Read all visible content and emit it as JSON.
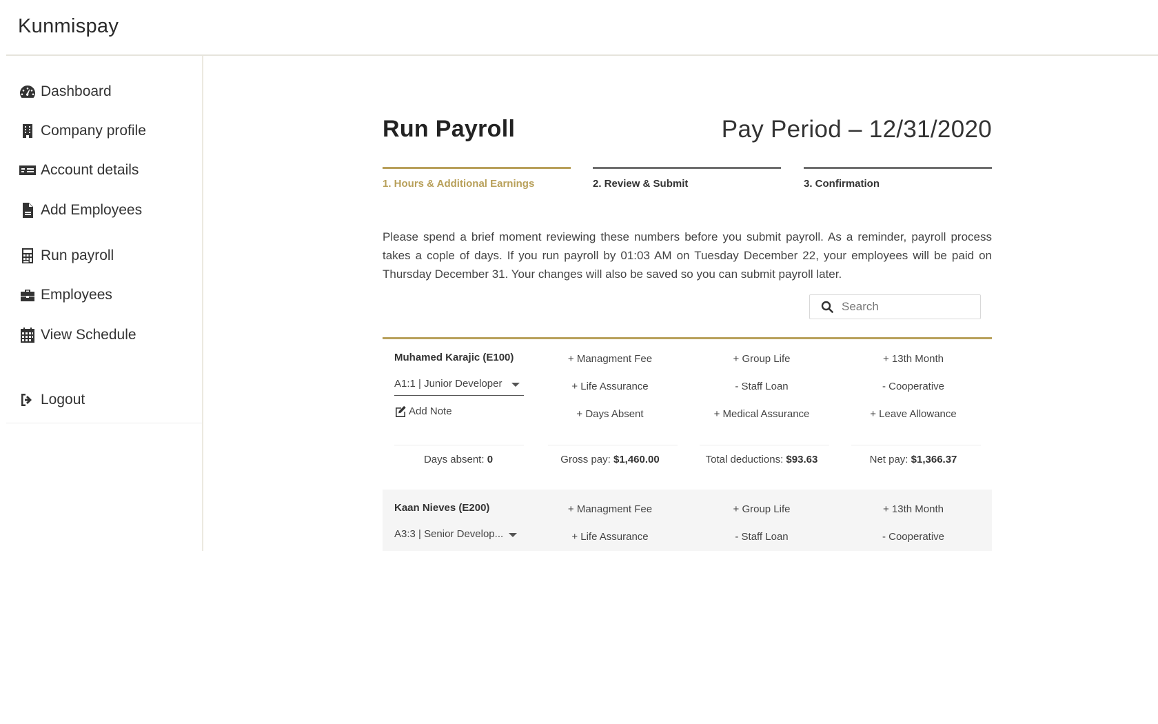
{
  "app": {
    "brand": "Kunmispay"
  },
  "sidebar": {
    "items": [
      {
        "label": "Dashboard",
        "icon": "dashboard-icon"
      },
      {
        "label": "Company profile",
        "icon": "building-icon"
      },
      {
        "label": "Account details",
        "icon": "money-check-icon"
      },
      {
        "label": "Add Employees",
        "icon": "csv-file-icon"
      },
      {
        "label": "Run payroll",
        "icon": "calculator-icon"
      },
      {
        "label": "Employees",
        "icon": "briefcase-icon"
      },
      {
        "label": "View Schedule",
        "icon": "calendar-icon"
      }
    ],
    "logout": {
      "label": "Logout",
      "icon": "sign-out-icon"
    }
  },
  "main": {
    "title": "Run Payroll",
    "pay_period": "Pay Period – 12/31/2020",
    "steps": [
      {
        "label": "1. Hours & Additional Earnings",
        "active": true
      },
      {
        "label": "2. Review & Submit",
        "active": false
      },
      {
        "label": "3. Confirmation",
        "active": false
      }
    ],
    "intro": "Please spend a brief moment reviewing these numbers before you submit payroll. As a reminder, payroll process takes a cople of days. If you run payroll by 01:03 AM on Tuesday December 22, your employees will be paid on Thursday December 31. Your changes will also be saved so you can submit payroll later.",
    "search": {
      "placeholder": "Search"
    }
  },
  "employees": [
    {
      "name": "Muhamed Karajic (E100)",
      "role": "A1:1 | Junior Developer",
      "add_note": "Add Note",
      "items": [
        "+ Managment Fee",
        "+ Group Life",
        "+ 13th Month",
        "+ Life Assurance",
        "- Staff Loan",
        "- Cooperative",
        "+ Days Absent",
        "+ Medical Assurance",
        "+ Leave Allowance"
      ],
      "summary": {
        "days_absent_label": "Days absent:",
        "days_absent": "0",
        "gross_label": "Gross pay:",
        "gross": "$1,460.00",
        "deductions_label": "Total deductions:",
        "deductions": "$93.63",
        "net_label": "Net pay:",
        "net": "$1,366.37"
      }
    },
    {
      "name": "Kaan Nieves (E200)",
      "role": "A3:3 | Senior Develop...",
      "items": [
        "+ Managment Fee",
        "+ Group Life",
        "+ 13th Month",
        "+ Life Assurance",
        "- Staff Loan",
        "- Cooperative"
      ]
    }
  ],
  "colors": {
    "accent": "#b8a05a",
    "step_inactive": "#6e6e6e",
    "alt_row": "#f5f5f5"
  }
}
